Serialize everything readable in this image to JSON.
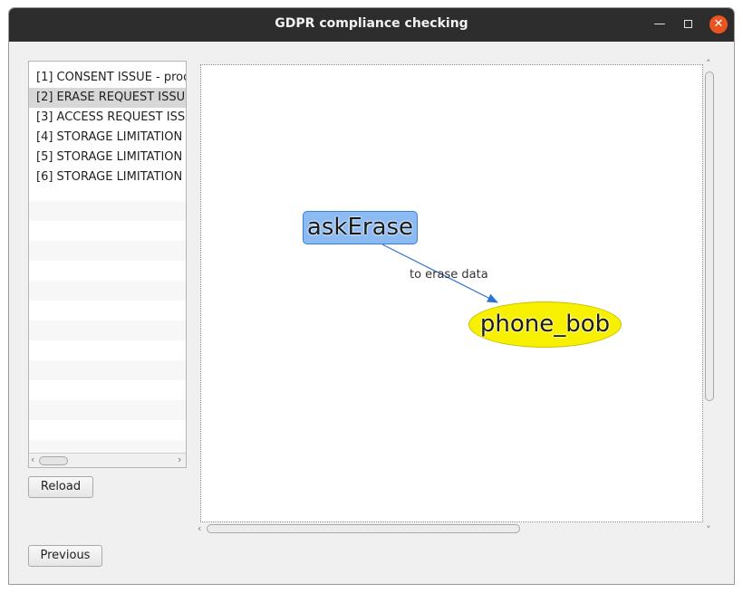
{
  "window": {
    "title": "GDPR compliance checking"
  },
  "issues": [
    {
      "label": "[1] CONSENT ISSUE - proc"
    },
    {
      "label": "[2] ERASE REQUEST ISSU"
    },
    {
      "label": "[3] ACCESS REQUEST ISS"
    },
    {
      "label": "[4] STORAGE LIMITATION"
    },
    {
      "label": "[5] STORAGE LIMITATION"
    },
    {
      "label": "[6] STORAGE LIMITATION"
    }
  ],
  "selected_issue": 2,
  "buttons": {
    "reload": "Reload",
    "previous": "Previous"
  },
  "graph": {
    "nodes": [
      {
        "id": "askErase",
        "label": "askErase",
        "shape": "rounded-rect",
        "fill": "#8cbaf2"
      },
      {
        "id": "phone_bob",
        "label": "phone_bob",
        "shape": "ellipse",
        "fill": "#f7f000"
      }
    ],
    "edges": [
      {
        "from": "askErase",
        "to": "phone_bob",
        "label": "to erase data",
        "color": "#2f73d4"
      }
    ]
  },
  "colors": {
    "titlebar": "#2d2d2d",
    "close": "#e95420",
    "selection": "#d7d7d7"
  }
}
